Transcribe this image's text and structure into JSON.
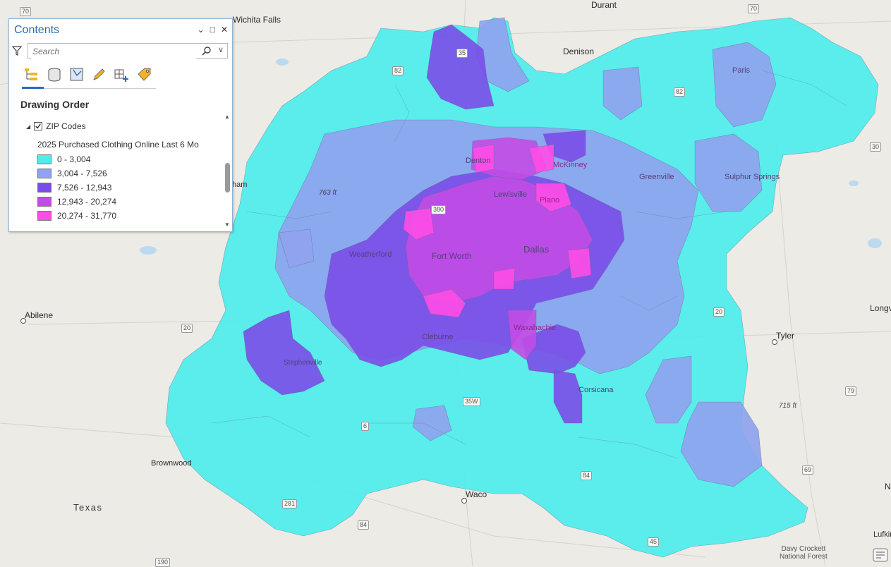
{
  "contents_pane": {
    "title": "Contents",
    "search_placeholder": "Search",
    "section_title": "Drawing Order",
    "layer_name": "ZIP Codes",
    "layer_checked": true,
    "toolbar_icons": [
      "list-by-drawing-order-icon",
      "list-by-source-icon",
      "list-by-selection-icon",
      "list-by-editing-icon",
      "list-by-snapping-icon",
      "list-by-labeling-icon"
    ],
    "legend": {
      "title": "2025 Purchased Clothing Online Last 6 Mo",
      "classes": [
        {
          "label": "0 - 3,004",
          "color": "#4deded"
        },
        {
          "label": "3,004 - 7,526",
          "color": "#8fa3ee"
        },
        {
          "label": "7,526 - 12,943",
          "color": "#7a4de8"
        },
        {
          "label": "12,943 - 20,274",
          "color": "#c24de6"
        },
        {
          "label": "20,274 - 31,770",
          "color": "#ff4de6"
        }
      ]
    }
  },
  "map": {
    "basemap_color": "#ecebe6",
    "places": {
      "wichita_falls": "Wichita Falls",
      "durant": "Durant",
      "denison": "Denison",
      "paris": "Paris",
      "denton": "Denton",
      "mckinney": "McKinney",
      "greenville": "Greenville",
      "sulphur_springs": "Sulphur Springs",
      "lewisville": "Lewisville",
      "plano": "Plano",
      "weatherford": "Weatherford",
      "fort_worth": "Fort Worth",
      "dallas": "Dallas",
      "abilene": "Abilene",
      "cleburne": "Cleburne",
      "waxahachie": "Waxahachie",
      "tyler": "Tyler",
      "longview": "Longv",
      "stephenville": "Stephenville",
      "corsicana": "Corsicana",
      "brownwood": "Brownwood",
      "waco": "Waco",
      "texas": "Texas",
      "davy_crockett": "Davy Crockett\nNational Forest",
      "lufkin": "Lufkin",
      "nac": "N",
      "partial_cut": "ham",
      "elev_715": "715 ft",
      "elev_763": "763 ft"
    },
    "highway_shields": {
      "i70a": "70",
      "i70b": "70",
      "i35": "35",
      "us82a": "82",
      "us82b": "82",
      "us380": "380",
      "i30": "30",
      "i20a": "20",
      "i20b": "20",
      "us79": "79",
      "us69": "69",
      "us84a": "84",
      "us84b": "84",
      "us281": "281",
      "us190": "190",
      "us45": "45",
      "us6": "6",
      "i35w": "35W"
    }
  }
}
